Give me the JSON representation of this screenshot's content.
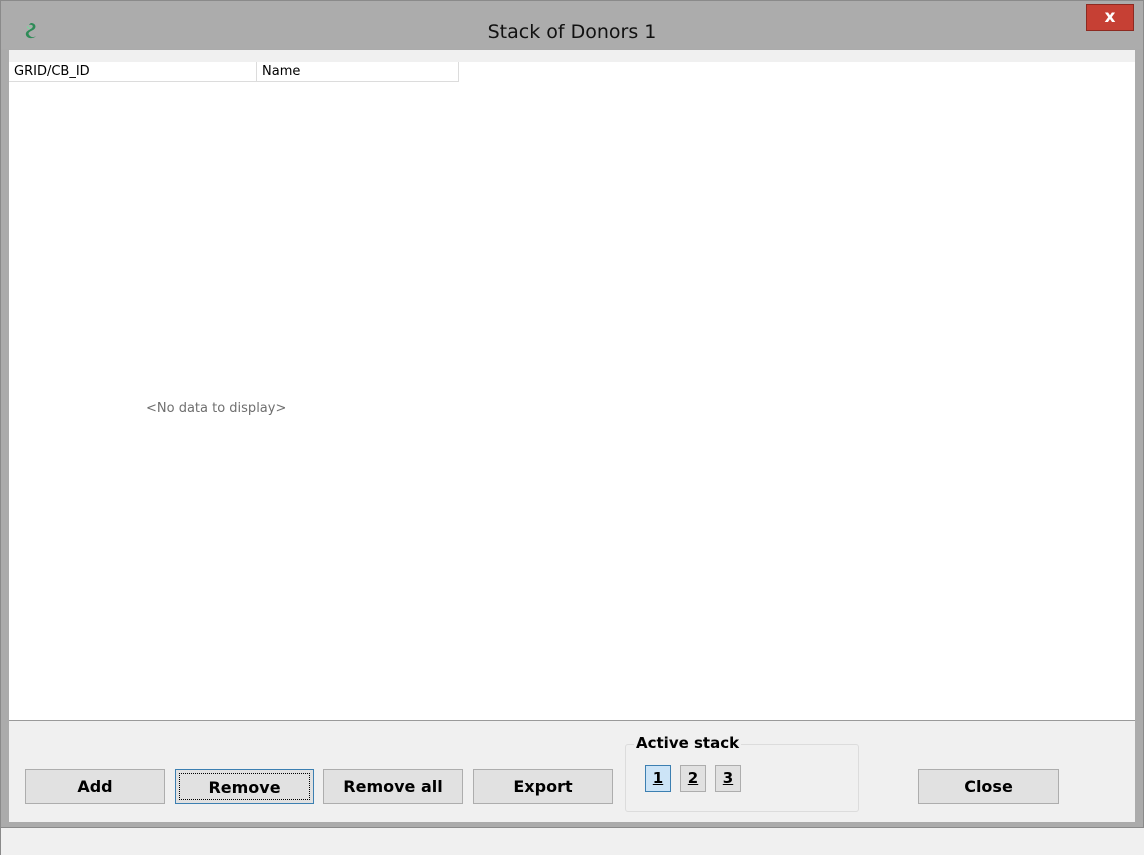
{
  "window": {
    "title": "Stack of Donors 1",
    "close_label": "x"
  },
  "grid": {
    "columns": [
      "GRID/CB_ID",
      "Name"
    ],
    "empty_text": "<No data to display>"
  },
  "buttons": {
    "add": "Add",
    "remove": "Remove",
    "remove_all": "Remove all",
    "export": "Export",
    "close": "Close"
  },
  "active_stack": {
    "label": "Active stack",
    "options": [
      "1",
      "2",
      "3"
    ],
    "selected": "1"
  },
  "colors": {
    "close_button": "#c64034",
    "app_icon": "#2e8b57",
    "active_stack_bg": "#cce4f7"
  },
  "icons": {
    "app": "app-logo-icon"
  }
}
